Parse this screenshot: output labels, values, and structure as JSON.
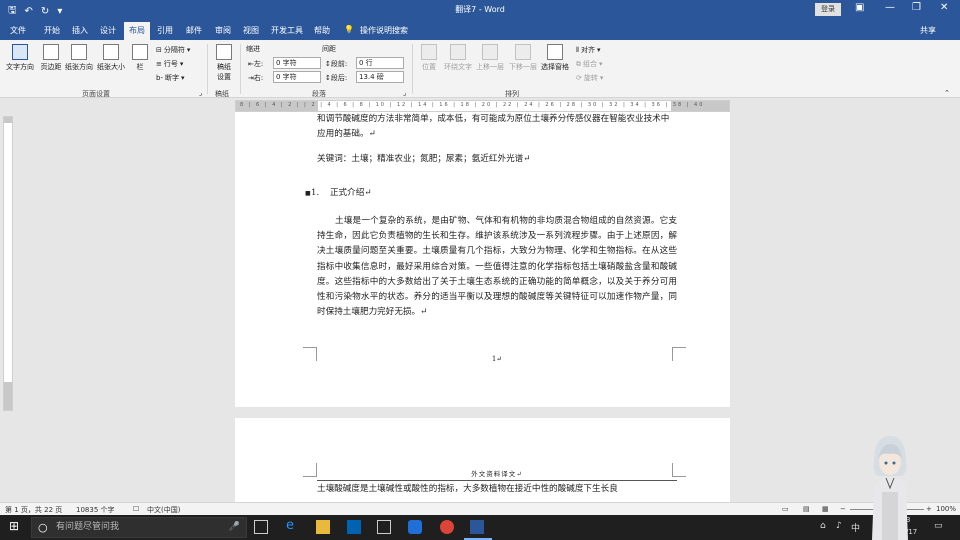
{
  "titlebar": {
    "title": "翻译7 - Word",
    "login": "登录",
    "min": "—",
    "restore": "❐",
    "close": "✕"
  },
  "tabs": [
    "文件",
    "开始",
    "插入",
    "设计",
    "布局",
    "引用",
    "邮件",
    "审阅",
    "视图",
    "开发工具",
    "帮助"
  ],
  "tell_me": "操作说明搜索",
  "share": "共享",
  "ribbon": {
    "text_direction": "文字方向",
    "margins": "页边距",
    "orientation": "纸张方向",
    "size": "纸张大小",
    "columns": "栏",
    "breaks": "分隔符",
    "line_numbers": "行号",
    "hyphenation": "断字",
    "page_setup_group": "页面设置",
    "draft_settings": "稿纸设置",
    "draft_group": "稿纸",
    "indent_label": "缩进",
    "spacing_label": "间距",
    "indent_left_label": "左:",
    "indent_left_value": "0 字符",
    "indent_right_label": "右:",
    "indent_right_value": "0 字符",
    "space_before_label": "段前:",
    "space_before_value": "0 行",
    "space_after_label": "段后:",
    "space_after_value": "13.4 磅",
    "paragraph_group": "段落",
    "position": "位置",
    "wrap_text": "环绕文字",
    "bring_forward": "上移一层",
    "send_backward": "下移一层",
    "selection_pane": "选择窗格",
    "align": "对齐",
    "group": "组合",
    "rotate": "旋转",
    "arrange_group": "排列"
  },
  "ruler": {
    "ticks": "8 | 6 | 4 | 2 |   | 2 | 4 | 6 | 8 | 10 | 12 | 14 | 16 | 18 | 20 | 22 | 24 | 26 | 28 | 30 | 32 | 34 | 36 | 38 | 40"
  },
  "document": {
    "p_intro_end": "和调节酸碱度的方法非常简单，成本低，有可能成为原位土壤养分传感仪器在智能农业技术中应用的基础。↵",
    "keywords": "关键词：土壤；精准农业；氮肥；尿素；氨近红外光谱↵",
    "heading_num": "1.",
    "heading": "正式介绍↵",
    "body": "土壤是一个复杂的系统，是由矿物、气体和有机物的非均质混合物组成的自然资源。它支持生命，因此它负责植物的生长和生存。维护该系统涉及一系列流程步骤。由于上述原因，解决土壤质量问题至关重要。土壤质量有几个指标，大致分为物理、化学和生物指标。在从这些指标中收集信息时，最好采用综合对策。一些值得注意的化学指标包括土壤硝酸盐含量和酸碱度。这些指标中的大多数给出了关于土壤生态系统的正确功能的简单概念，以及关于养分可用性和污染物水平的状态。养分的适当平衡以及理想的酸碱度等关键特征可以加速作物产量，同时保持土壤肥力完好无损。↵",
    "page_number": "1↵",
    "page2_header": "外文资料译文↵",
    "page2_line": "土壤酸碱度是土壤碱性或酸性的指标，大多数植物在接近中性的酸碱度下生长良"
  },
  "statusbar": {
    "page": "第 1 页，共 22 页",
    "words": "10835 个字",
    "lang": "中文(中国)",
    "zoom": "100%",
    "minus": "−",
    "plus": "+"
  },
  "taskbar": {
    "search_placeholder": "有问题尽管问我",
    "ime": "中",
    "date_a": "3",
    "date_b": "/17"
  }
}
